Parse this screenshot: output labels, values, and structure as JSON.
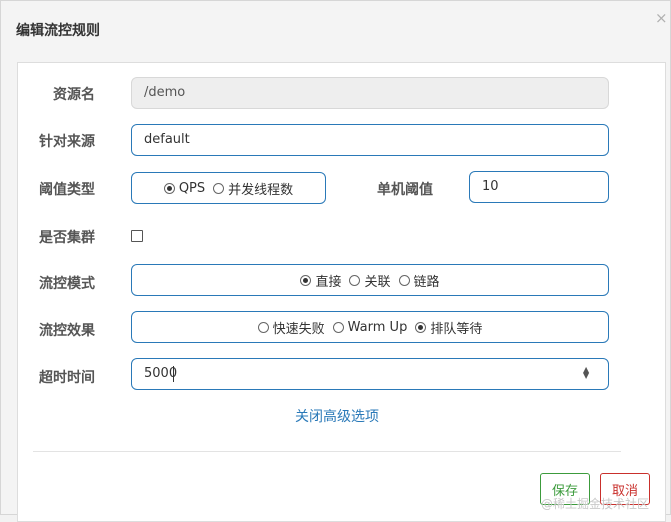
{
  "dialog": {
    "title": "编辑流控规则",
    "close_symbol": "×"
  },
  "form": {
    "resource_label": "资源名",
    "resource_value": "/demo",
    "source_label": "针对来源",
    "source_value": "default",
    "threshold_type_label": "阈值类型",
    "threshold_type_options": [
      "QPS",
      "并发线程数"
    ],
    "threshold_type_selected": "QPS",
    "single_threshold_label": "单机阈值",
    "single_threshold_value": "10",
    "cluster_label": "是否集群",
    "cluster_checked": false,
    "mode_label": "流控模式",
    "mode_options": [
      "直接",
      "关联",
      "链路"
    ],
    "mode_selected": "直接",
    "effect_label": "流控效果",
    "effect_options": [
      "快速失败",
      "Warm Up",
      "排队等待"
    ],
    "effect_selected": "排队等待",
    "timeout_label": "超时时间",
    "timeout_value": "5000",
    "advanced_link": "关闭高级选项"
  },
  "footer": {
    "save_label": "保存",
    "cancel_label": "取消"
  },
  "watermark": "@稀土掘金技术社区",
  "colors": {
    "accent": "#2a79b8",
    "save": "#3c9b3c",
    "cancel": "#c9302c"
  }
}
